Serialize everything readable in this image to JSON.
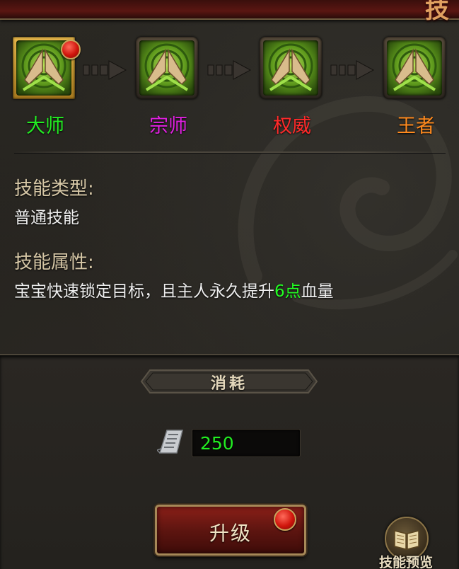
{
  "header": {
    "title_partial": "技"
  },
  "tiers": [
    {
      "name": "大师",
      "color": "#22ee22",
      "selected": true,
      "has_notification": true
    },
    {
      "name": "宗师",
      "color": "#e020e0",
      "selected": false,
      "has_notification": false
    },
    {
      "name": "权威",
      "color": "#ff2a2a",
      "selected": false,
      "has_notification": false
    },
    {
      "name": "王者",
      "color": "#ff8a1e",
      "selected": false,
      "has_notification": false
    }
  ],
  "skill": {
    "type_label": "技能类型:",
    "type_value": "普通技能",
    "attribute_label": "技能属性:",
    "attribute_prefix": "宝宝快速锁定目标，且主人永久提升",
    "attribute_highlight": "6点",
    "attribute_suffix": "血量",
    "highlight_color": "#22ff22"
  },
  "cost": {
    "title": "消耗",
    "icon": "skill-book-scroll-icon",
    "value": "250",
    "value_color": "#22ee22"
  },
  "buttons": {
    "upgrade_label": "升级",
    "upgrade_has_notification": true,
    "preview_label": "技能预览",
    "preview_icon": "open-book-icon"
  },
  "colors": {
    "title_strip": "#5a1612",
    "button_red": "#8a1f18",
    "gold_frame": "#e6b64a",
    "label_text": "#d6c7a6"
  }
}
